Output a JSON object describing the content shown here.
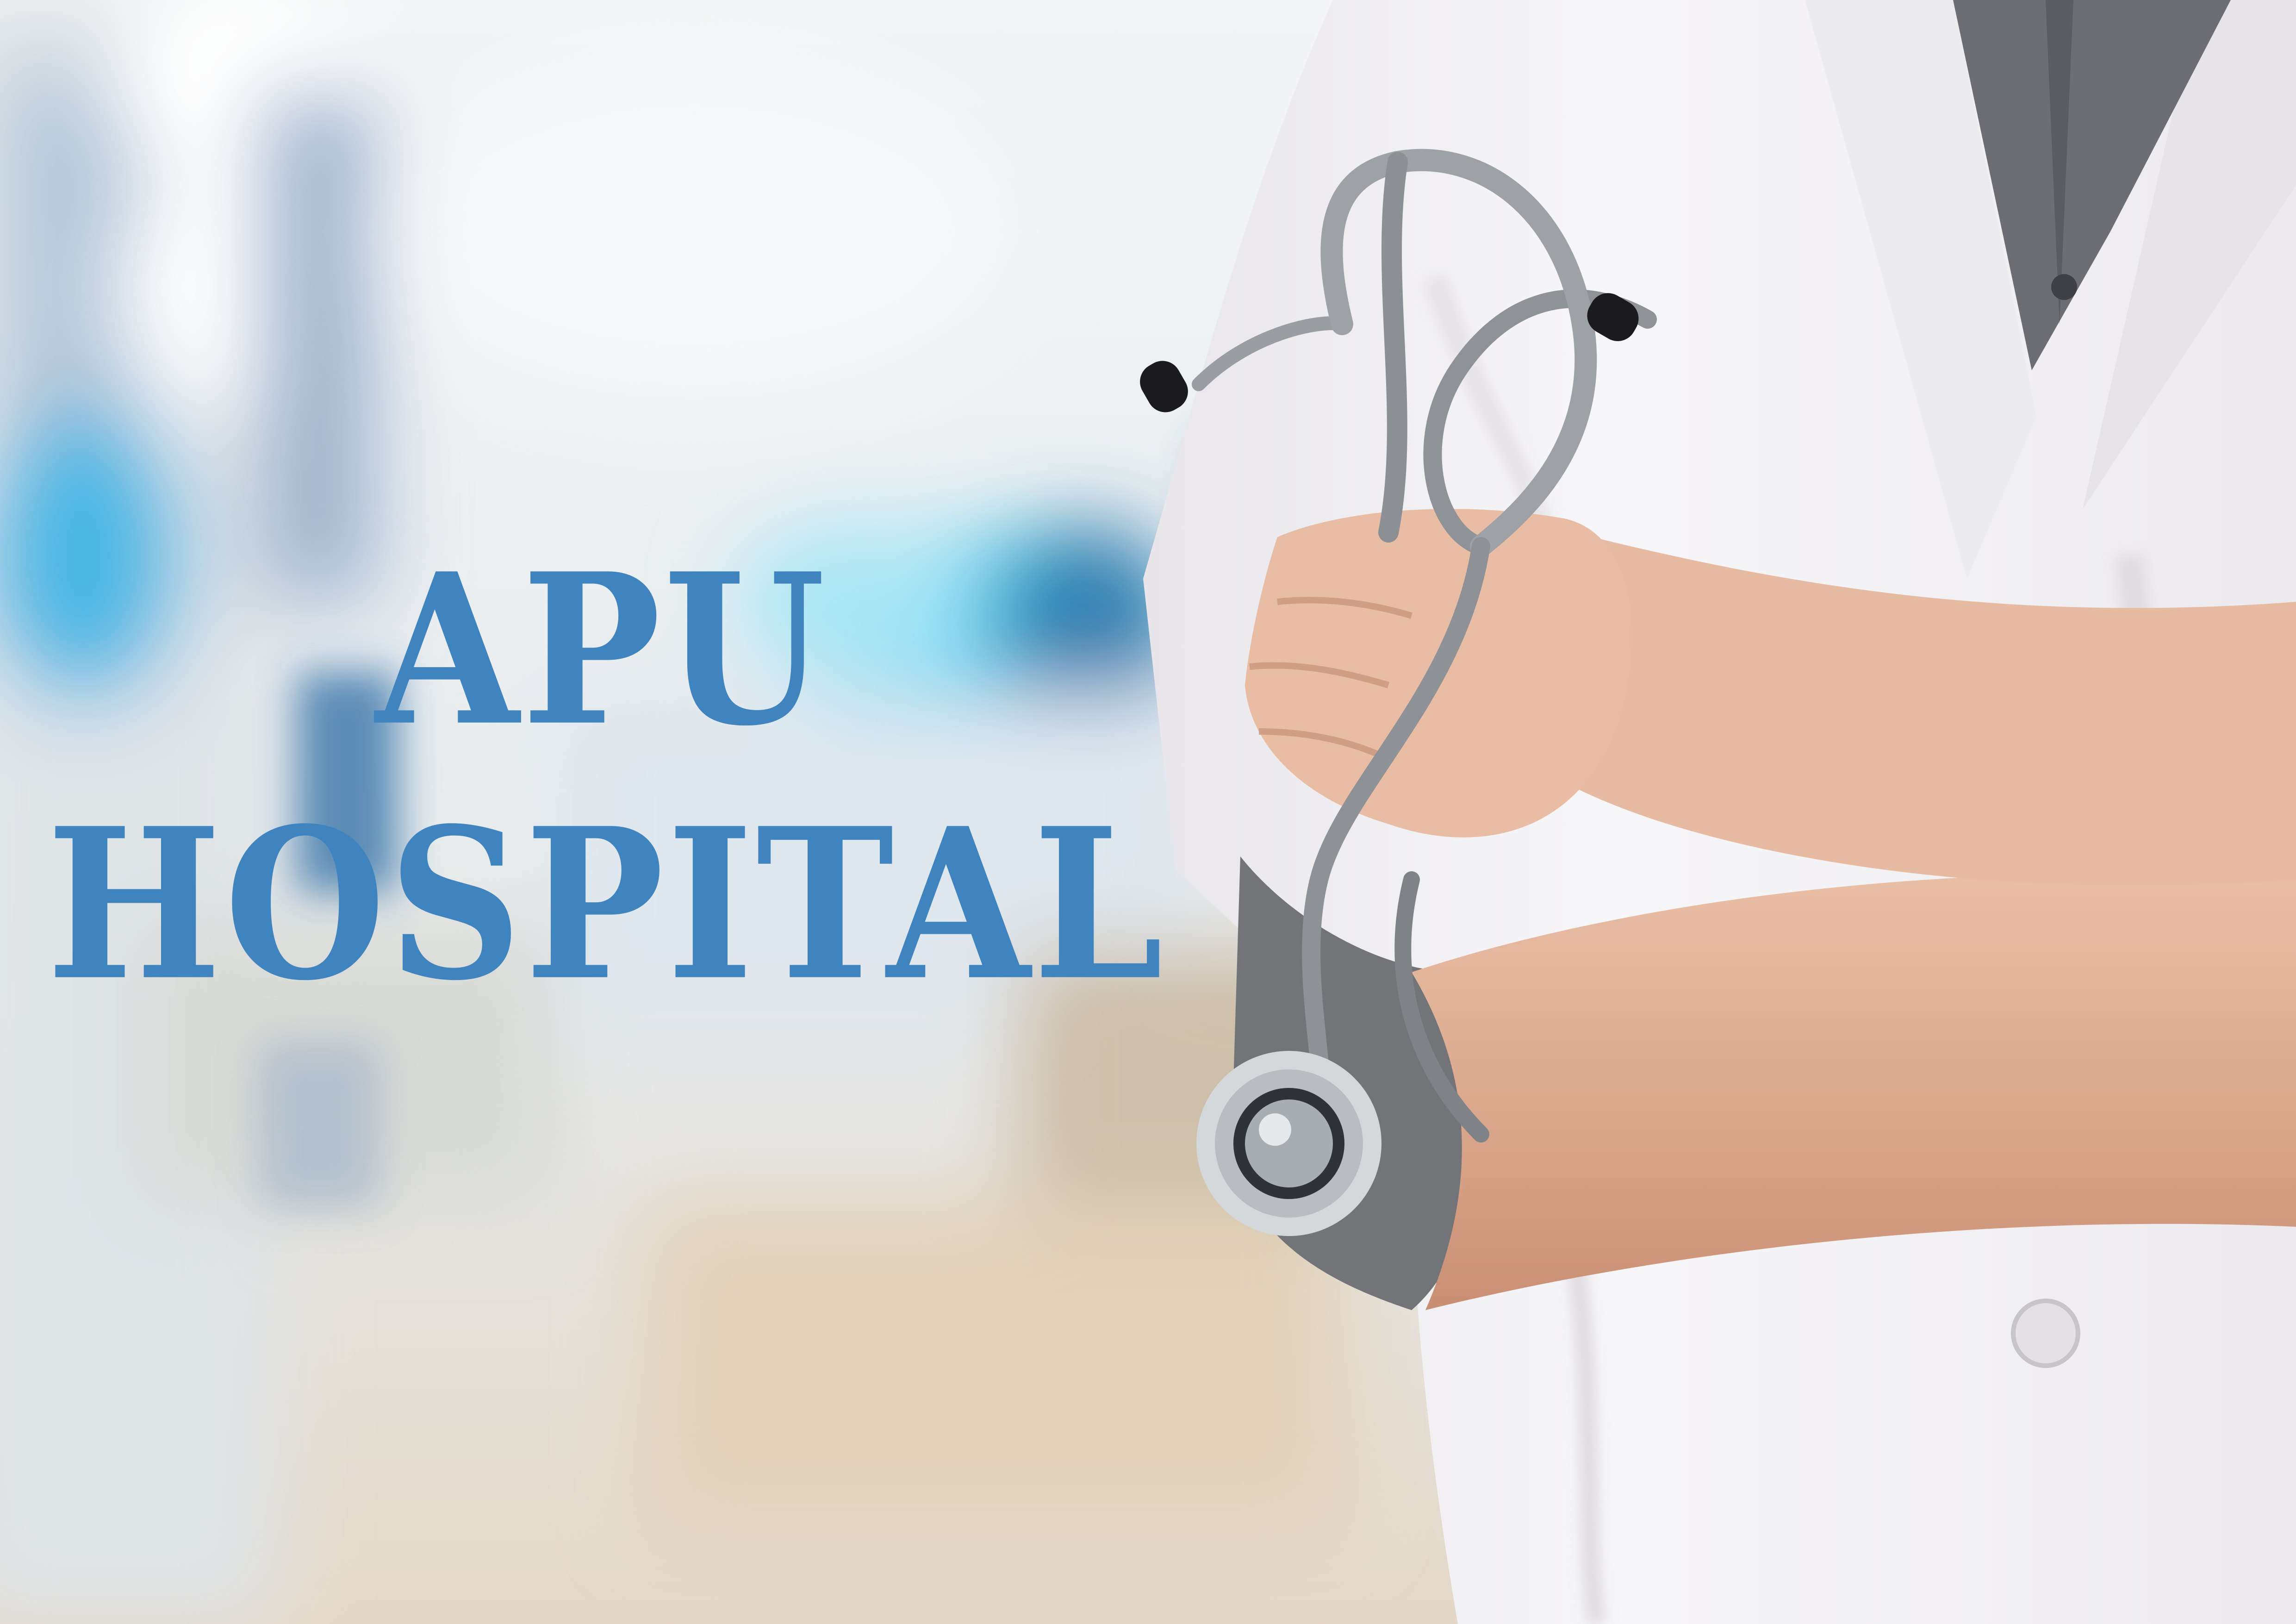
{
  "image": {
    "subject": "doctor-with-stethoscope",
    "title_line_1": "APU",
    "title_line_2": "HOSPITAL"
  },
  "colors": {
    "title": "#3f83bf",
    "coat": "#f4f3f5",
    "shirt": "#6e7075",
    "skin": "#e3b49a",
    "stethoscope": "#9ea2a6"
  }
}
